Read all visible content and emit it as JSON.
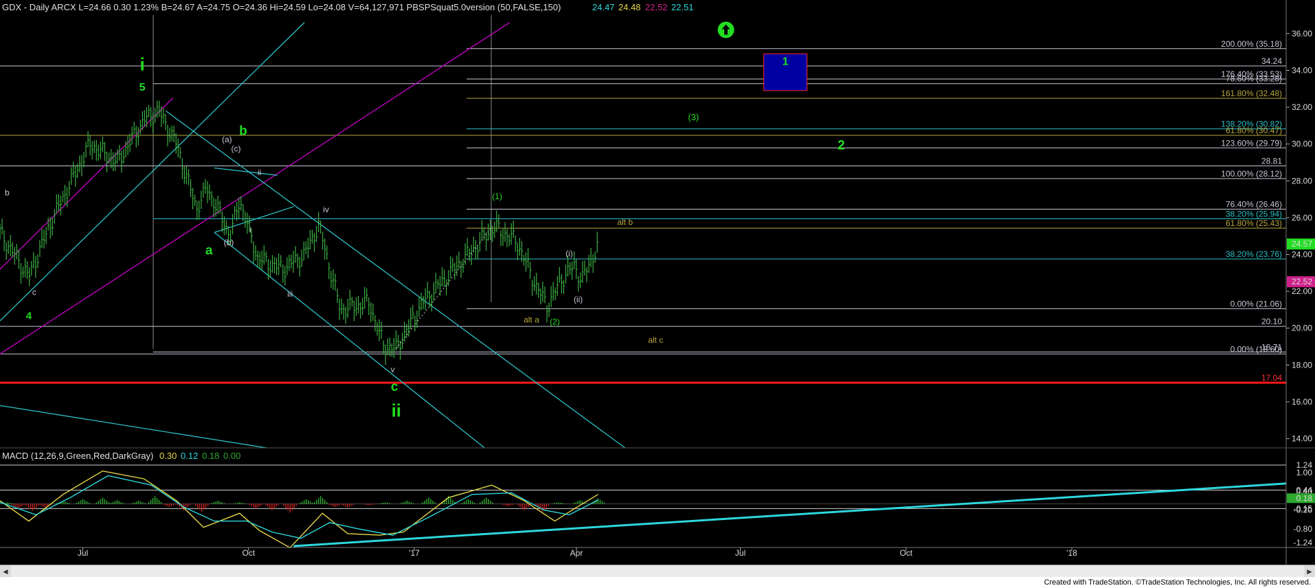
{
  "window": {
    "header_text": "GDX - Daily  ARCX  L=24.66  0.30  1.23%  B=24.67  A=24.75  O=24.36  Hi=24.59  Lo=24.08  V=64,127,971  PBSPSquat5.0version (50,FALSE,150)",
    "header_values": [
      "24.47",
      "24.48",
      "22.52",
      "22.51"
    ],
    "macd_header": "MACD (12,26,9,Green,Red,DarkGray)",
    "macd_values": [
      "0.30",
      "0.12",
      "0.18",
      "0.00"
    ],
    "footer": "Created with TradeStation. ©TradeStation Technologies, Inc. All rights reserved.",
    "scroll_left": "◄",
    "scroll_right": "►"
  },
  "colors": {
    "background": "#000000",
    "bars": "#3cb043",
    "magenta": "#c800c8",
    "cyan": "#2cc0c8",
    "fib_white": "#c8c8d8",
    "fib_yellow": "#b8a840",
    "green_label": "#22dd22",
    "red_line": "#ff1a1a",
    "macd_cyan": "#2ed7dc",
    "macd_yellow": "#e6d84a",
    "hist_green": "#2ea82e",
    "hist_red": "#c02020",
    "price_tag": "#22dd22",
    "price_tag_2": "#d0208a",
    "blue_box": "#0000a0"
  },
  "chart_data": [
    {
      "type": "candlestick",
      "title": "GDX - Daily",
      "ylim": [
        13.5,
        37
      ],
      "y_ticks": [
        14.0,
        16.0,
        18.0,
        20.0,
        22.0,
        24.0,
        26.0,
        28.0,
        30.0,
        32.0,
        34.0,
        36.0
      ],
      "x_tick_labels": [
        "Jul",
        "Oct",
        "'17",
        "Apr",
        "Jul",
        "Oct",
        "'18"
      ],
      "last_price": 24.57,
      "secondary_tag": 22.52,
      "price_path": [
        [
          "2016-05-16",
          25.2
        ],
        [
          "2016-06-01",
          22.8
        ],
        [
          "2016-06-14",
          25.9
        ],
        [
          "2016-07-05",
          30.0
        ],
        [
          "2016-07-20",
          29.0
        ],
        [
          "2016-08-04",
          31.3
        ],
        [
          "2016-08-12",
          31.8
        ],
        [
          "2016-08-22",
          30.0
        ],
        [
          "2016-09-02",
          26.5
        ],
        [
          "2016-09-08",
          27.6
        ],
        [
          "2016-09-21",
          25.0
        ],
        [
          "2016-09-26",
          27.0
        ],
        [
          "2016-10-06",
          23.8
        ],
        [
          "2016-10-20",
          23.2
        ],
        [
          "2016-11-01",
          24.0
        ],
        [
          "2016-11-09",
          25.6
        ],
        [
          "2016-11-21",
          21.0
        ],
        [
          "2016-12-07",
          21.4
        ],
        [
          "2016-12-15",
          19.0
        ],
        [
          "2016-12-22",
          18.9
        ],
        [
          "2017-01-05",
          21.3
        ],
        [
          "2017-01-20",
          22.9
        ],
        [
          "2017-02-02",
          24.2
        ],
        [
          "2017-02-14",
          25.5
        ],
        [
          "2017-02-27",
          24.7
        ],
        [
          "2017-03-10",
          22.2
        ],
        [
          "2017-03-16",
          21.2
        ],
        [
          "2017-03-24",
          22.7
        ],
        [
          "2017-03-31",
          23.4
        ],
        [
          "2017-04-04",
          22.6
        ],
        [
          "2017-04-13",
          24.5
        ]
      ],
      "horizontal_levels": [
        {
          "value": 35.18,
          "label": "200.00% (35.18)",
          "color": "fib_white",
          "from": "2017-01-30"
        },
        {
          "value": 34.24,
          "label": "34.24",
          "color": "fib_white",
          "from": "2016-05-16"
        },
        {
          "value": 33.53,
          "label": "176.40% (33.53)",
          "color": "fib_white",
          "from": "2017-01-30"
        },
        {
          "value": 33.28,
          "label": "78.60% (33.28)",
          "color": "fib_white",
          "from": "2016-08-09"
        },
        {
          "value": 32.48,
          "label": "161.80% (32.48)",
          "color": "fib_yellow",
          "from": "2017-01-30"
        },
        {
          "value": 30.82,
          "label": "138.20% (30.82)",
          "color": "cyan",
          "from": "2017-01-30"
        },
        {
          "value": 30.47,
          "label": "61.80% (30.47)",
          "color": "fib_yellow",
          "from": "2016-05-16"
        },
        {
          "value": 29.79,
          "label": "123.60% (29.79)",
          "color": "fib_white",
          "from": "2017-01-30"
        },
        {
          "value": 28.81,
          "label": "28.81",
          "color": "fib_white",
          "from": "2016-05-16"
        },
        {
          "value": 28.12,
          "label": "100.00% (28.12)",
          "color": "fib_white",
          "from": "2017-01-30"
        },
        {
          "value": 26.46,
          "label": "76.40% (26.46)",
          "color": "fib_white",
          "from": "2017-01-30"
        },
        {
          "value": 25.94,
          "label": "38.20% (25.94)",
          "color": "cyan",
          "from": "2016-08-09"
        },
        {
          "value": 25.43,
          "label": "61.80% (25.43)",
          "color": "fib_yellow",
          "from": "2017-01-30"
        },
        {
          "value": 23.76,
          "label": "38.20% (23.76)",
          "color": "cyan",
          "from": "2017-01-30"
        },
        {
          "value": 21.06,
          "label": "0.00% (21.06)",
          "color": "fib_white",
          "from": "2017-01-30"
        },
        {
          "value": 20.1,
          "label": "20.10",
          "color": "fib_white",
          "from": "2016-05-16"
        },
        {
          "value": 18.71,
          "label": "18.71",
          "color": "fib_white",
          "from": "2016-08-09"
        },
        {
          "value": 18.6,
          "label": "0.00% (18.60)",
          "color": "fib_white",
          "from": "2016-05-16"
        },
        {
          "value": 17.04,
          "label": "17.04",
          "color": "red_line",
          "from": "2016-05-16"
        }
      ],
      "target_box": {
        "label": "1",
        "from": "2017-07-14",
        "to": "2017-08-07",
        "low": 32.9,
        "high": 34.9
      },
      "channels": [
        {
          "color": "magenta",
          "from": [
            "2016-05-16",
            23.2
          ],
          "to": [
            "2016-08-20",
            32.5
          ]
        },
        {
          "color": "magenta",
          "from": [
            "2016-05-16",
            18.6
          ],
          "to": [
            "2017-02-23",
            36.6
          ]
        },
        {
          "color": "cyan",
          "from": [
            "2016-05-16",
            20.4
          ],
          "to": [
            "2016-11-01",
            36.6
          ]
        },
        {
          "color": "cyan",
          "from": [
            "2016-08-16",
            31.8
          ],
          "to": [
            "2017-04-28",
            13.5
          ]
        },
        {
          "color": "cyan",
          "from": [
            "2016-09-12",
            25.2
          ],
          "to": [
            "2017-02-09",
            13.5
          ]
        },
        {
          "color": "cyan",
          "from": [
            "2016-09-12",
            25.2
          ],
          "to": [
            "2016-10-26",
            26.6
          ]
        },
        {
          "color": "cyan",
          "from": [
            "2016-09-12",
            28.7
          ],
          "to": [
            "2016-10-17",
            28.3
          ]
        },
        {
          "color": "cyan",
          "from": [
            "2016-05-16",
            15.8
          ],
          "to": [
            "2016-10-11",
            13.5
          ]
        }
      ],
      "annotations": [
        {
          "text": "i",
          "date": "2016-08-03",
          "y": 34.0,
          "color": "green_label",
          "size": 26,
          "bold": true
        },
        {
          "text": "5",
          "date": "2016-08-03",
          "y": 32.9,
          "color": "green_label",
          "size": 16,
          "bold": true
        },
        {
          "text": "b",
          "date": "2016-05-20",
          "y": 27.2,
          "color": "fib_white",
          "size": 12
        },
        {
          "text": "c",
          "date": "2016-06-04",
          "y": 21.8,
          "color": "fib_white",
          "size": 12
        },
        {
          "text": "4",
          "date": "2016-06-01",
          "y": 20.5,
          "color": "green_label",
          "size": 15,
          "bold": true
        },
        {
          "text": "(a)",
          "date": "2016-09-19",
          "y": 30.1,
          "color": "fib_white",
          "size": 12
        },
        {
          "text": "b",
          "date": "2016-09-28",
          "y": 30.5,
          "color": "green_label",
          "size": 19,
          "bold": true
        },
        {
          "text": "(c)",
          "date": "2016-09-24",
          "y": 29.6,
          "color": "fib_white",
          "size": 12
        },
        {
          "text": "ii",
          "date": "2016-10-07",
          "y": 28.3,
          "color": "fib_white",
          "size": 12
        },
        {
          "text": "i",
          "date": "2016-10-02",
          "y": 25.2,
          "color": "fib_white",
          "size": 12
        },
        {
          "text": "(b)",
          "date": "2016-09-20",
          "y": 24.5,
          "color": "fib_white",
          "size": 12
        },
        {
          "text": "a",
          "date": "2016-09-09",
          "y": 24.0,
          "color": "green_label",
          "size": 19,
          "bold": true
        },
        {
          "text": "iv",
          "date": "2016-11-13",
          "y": 26.3,
          "color": "fib_white",
          "size": 12
        },
        {
          "text": "iii",
          "date": "2016-10-24",
          "y": 21.7,
          "color": "fib_white",
          "size": 12
        },
        {
          "text": "v",
          "date": "2016-12-20",
          "y": 17.6,
          "color": "fib_white",
          "size": 12
        },
        {
          "text": "c",
          "date": "2016-12-21",
          "y": 16.6,
          "color": "green_label",
          "size": 19,
          "bold": true
        },
        {
          "text": "ii",
          "date": "2016-12-22",
          "y": 15.2,
          "color": "green_label",
          "size": 26,
          "bold": true
        },
        {
          "text": "(1)",
          "date": "2017-02-16",
          "y": 27.0,
          "color": "green_label",
          "size": 12
        },
        {
          "text": "(3)",
          "date": "2017-06-05",
          "y": 31.3,
          "color": "green_label",
          "size": 13
        },
        {
          "text": "2",
          "date": "2017-08-26",
          "y": 29.7,
          "color": "green_label",
          "size": 19,
          "bold": true
        },
        {
          "text": "alt b",
          "date": "2017-04-28",
          "y": 25.6,
          "color": "fib_yellow",
          "size": 12
        },
        {
          "text": "(i)",
          "date": "2017-03-28",
          "y": 23.9,
          "color": "fib_white",
          "size": 12
        },
        {
          "text": "(ii)",
          "date": "2017-04-02",
          "y": 21.4,
          "color": "fib_white",
          "size": 12
        },
        {
          "text": "alt a",
          "date": "2017-03-07",
          "y": 20.3,
          "color": "fib_yellow",
          "size": 12
        },
        {
          "text": "(2)",
          "date": "2017-03-20",
          "y": 20.2,
          "color": "green_label",
          "size": 12
        },
        {
          "text": "alt c",
          "date": "2017-05-15",
          "y": 19.2,
          "color": "fib_yellow",
          "size": 12
        }
      ],
      "arrow_up": {
        "date": "2017-06-23",
        "y": 36.2,
        "color": "green_label"
      }
    },
    {
      "type": "line",
      "title": "MACD (12,26,9,Green,Red,DarkGray)",
      "ylim": [
        -1.35,
        1.35
      ],
      "y_ticks": [
        -1.24,
        -0.8,
        -0.2,
        -0.15,
        0.18,
        0.4,
        0.44,
        1.0,
        1.24
      ],
      "series": [
        {
          "name": "MACD",
          "color": "macd_yellow",
          "values": [
            [
              "2016-05-16",
              0.1
            ],
            [
              "2016-06-01",
              -0.55
            ],
            [
              "2016-06-20",
              0.3
            ],
            [
              "2016-07-12",
              1.05
            ],
            [
              "2016-08-04",
              0.8
            ],
            [
              "2016-08-22",
              0.1
            ],
            [
              "2016-09-06",
              -0.75
            ],
            [
              "2016-09-26",
              -0.3
            ],
            [
              "2016-10-07",
              -0.85
            ],
            [
              "2016-10-24",
              -1.4
            ],
            [
              "2016-11-11",
              -0.3
            ],
            [
              "2016-11-25",
              -0.95
            ],
            [
              "2016-12-13",
              -1.0
            ],
            [
              "2016-12-26",
              -0.9
            ],
            [
              "2017-01-20",
              0.2
            ],
            [
              "2017-02-13",
              0.6
            ],
            [
              "2017-03-03",
              0.1
            ],
            [
              "2017-03-20",
              -0.55
            ],
            [
              "2017-03-31",
              -0.15
            ],
            [
              "2017-04-13",
              0.3
            ]
          ]
        },
        {
          "name": "Signal",
          "color": "macd_cyan",
          "values": [
            [
              "2016-05-16",
              0.05
            ],
            [
              "2016-06-05",
              -0.35
            ],
            [
              "2016-06-24",
              0.2
            ],
            [
              "2016-07-15",
              0.9
            ],
            [
              "2016-08-08",
              0.6
            ],
            [
              "2016-08-26",
              -0.1
            ],
            [
              "2016-09-12",
              -0.55
            ],
            [
              "2016-09-30",
              -0.55
            ],
            [
              "2016-10-14",
              -0.9
            ],
            [
              "2016-10-30",
              -1.1
            ],
            [
              "2016-11-15",
              -0.6
            ],
            [
              "2016-12-01",
              -0.8
            ],
            [
              "2016-12-20",
              -1.0
            ],
            [
              "2017-01-10",
              -0.4
            ],
            [
              "2017-02-02",
              0.3
            ],
            [
              "2017-02-24",
              0.35
            ],
            [
              "2017-03-14",
              -0.2
            ],
            [
              "2017-03-28",
              -0.35
            ],
            [
              "2017-04-13",
              0.12
            ]
          ]
        },
        {
          "name": "Trendline",
          "color": "macd_cyan",
          "values": [
            [
              "2016-10-26",
              -1.35
            ],
            [
              "2018-04-30",
              0.65
            ]
          ]
        }
      ],
      "histogram": [
        [
          "2016-05-20",
          0.05
        ],
        [
          "2016-05-26",
          -0.15
        ],
        [
          "2016-06-03",
          -0.22
        ],
        [
          "2016-06-10",
          -0.12
        ],
        [
          "2016-06-20",
          0.1
        ],
        [
          "2016-07-01",
          0.15
        ],
        [
          "2016-07-12",
          0.2
        ],
        [
          "2016-07-20",
          0.12
        ],
        [
          "2016-08-01",
          0.1
        ],
        [
          "2016-08-10",
          0.25
        ],
        [
          "2016-08-18",
          -0.1
        ],
        [
          "2016-08-26",
          -0.2
        ],
        [
          "2016-09-05",
          -0.25
        ],
        [
          "2016-09-14",
          0.1
        ],
        [
          "2016-09-26",
          0.05
        ],
        [
          "2016-10-05",
          -0.15
        ],
        [
          "2016-10-14",
          -0.2
        ],
        [
          "2016-10-24",
          -0.28
        ],
        [
          "2016-11-02",
          0.15
        ],
        [
          "2016-11-10",
          0.25
        ],
        [
          "2016-11-18",
          -0.1
        ],
        [
          "2016-11-25",
          -0.12
        ],
        [
          "2016-12-07",
          -0.05
        ],
        [
          "2016-12-16",
          0.05
        ],
        [
          "2016-12-28",
          0.1
        ],
        [
          "2017-01-09",
          0.2
        ],
        [
          "2017-01-20",
          0.25
        ],
        [
          "2017-01-31",
          0.15
        ],
        [
          "2017-02-10",
          0.2
        ],
        [
          "2017-02-22",
          -0.08
        ],
        [
          "2017-03-03",
          -0.2
        ],
        [
          "2017-03-13",
          -0.25
        ],
        [
          "2017-03-22",
          0.05
        ],
        [
          "2017-04-03",
          0.12
        ],
        [
          "2017-04-13",
          0.18
        ]
      ]
    }
  ]
}
